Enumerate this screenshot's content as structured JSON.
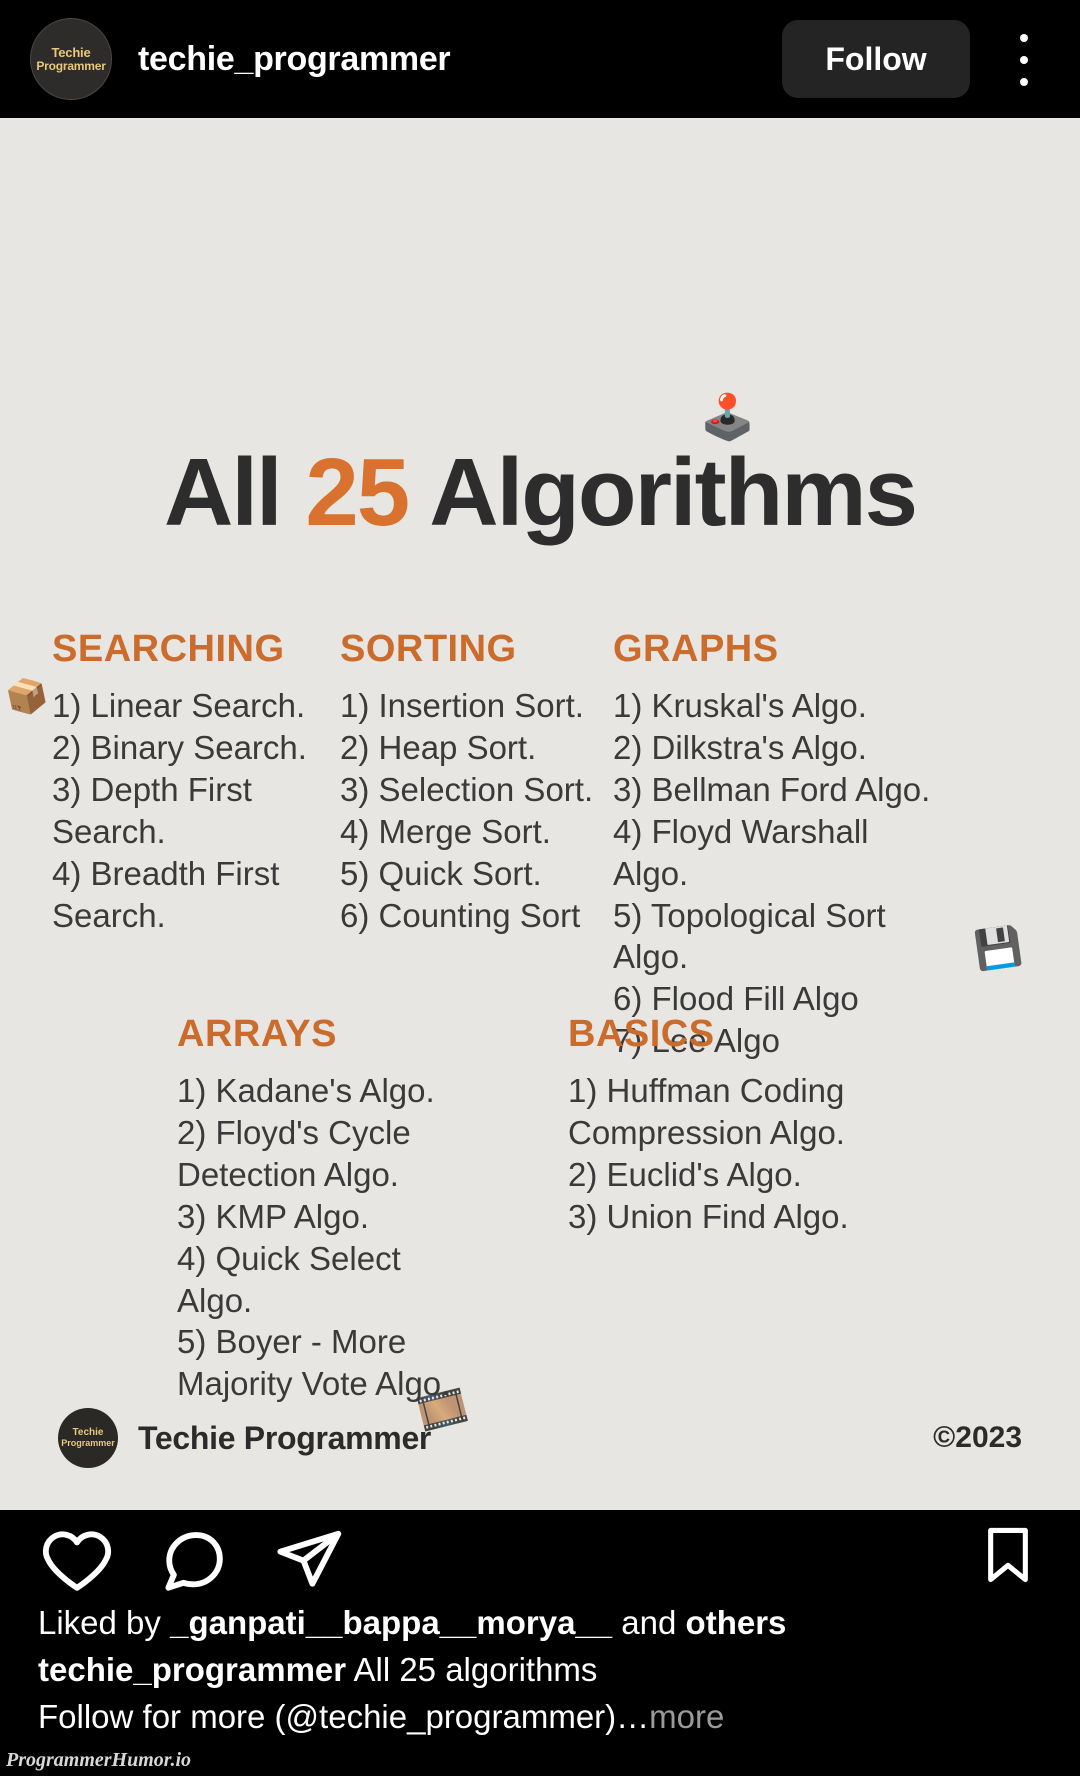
{
  "header": {
    "username": "techie_programmer",
    "follow_label": "Follow",
    "avatar_line1": "Techie",
    "avatar_line2": "Programmer",
    "menu_icon": "kebab-menu-icon"
  },
  "post": {
    "title_prefix": "All ",
    "title_number": "25",
    "title_suffix": " Algorithms",
    "accent_color": "#d9712f",
    "heading_color": "#cb6b2c",
    "background_color": "#e7e6e2",
    "decor": {
      "joystick": "🕹️",
      "cube": "📦",
      "floppy": "💾",
      "film": "🎞️"
    },
    "sections": [
      {
        "title": "SEARCHING",
        "items": [
          "1) Linear Search.",
          "2) Binary Search.",
          "3) Depth First Search.",
          "4) Breadth First Search."
        ]
      },
      {
        "title": "SORTING",
        "items": [
          "1) Insertion Sort.",
          "2) Heap Sort.",
          "3) Selection Sort.",
          "4) Merge Sort.",
          "5) Quick Sort.",
          "6) Counting Sort"
        ]
      },
      {
        "title": "GRAPHS",
        "items": [
          "1) Kruskal's Algo.",
          "2) Dilkstra's Algo.",
          "3) Bellman Ford Algo.",
          "4) Floyd Warshall Algo.",
          "5) Topological Sort Algo.",
          "6) Flood Fill Algo",
          "7) Lee Algo"
        ]
      },
      {
        "title": "ARRAYS",
        "items": [
          "1) Kadane's Algo.",
          "2) Floyd's Cycle Detection Algo.",
          "3) KMP Algo.",
          "4) Quick Select Algo.",
          "5) Boyer - More Majority Vote Algo."
        ]
      },
      {
        "title": "BASICS",
        "items": [
          "1) Huffman Coding Compression Algo.",
          "2) Euclid's Algo.",
          "3) Union Find Algo."
        ]
      }
    ],
    "footer": {
      "avatar_line1": "Techie",
      "avatar_line2": "Programmer",
      "brand_name": "Techie Programmer",
      "copyright": "©2023"
    }
  },
  "actions": {
    "like": "heart-icon",
    "comment": "comment-icon",
    "share": "share-icon",
    "save": "bookmark-icon"
  },
  "caption": {
    "liked_by_prefix": "Liked by ",
    "liked_by_user": "_ganpati__bappa__morya__",
    "liked_by_mid": " and ",
    "liked_by_others": "others",
    "author": "techie_programmer",
    "text_line1": " All 25 algorithms",
    "text_line2": "Follow for more (@techie_programmer)…",
    "more_label": "more"
  },
  "watermark": "ProgrammerHumor.io"
}
